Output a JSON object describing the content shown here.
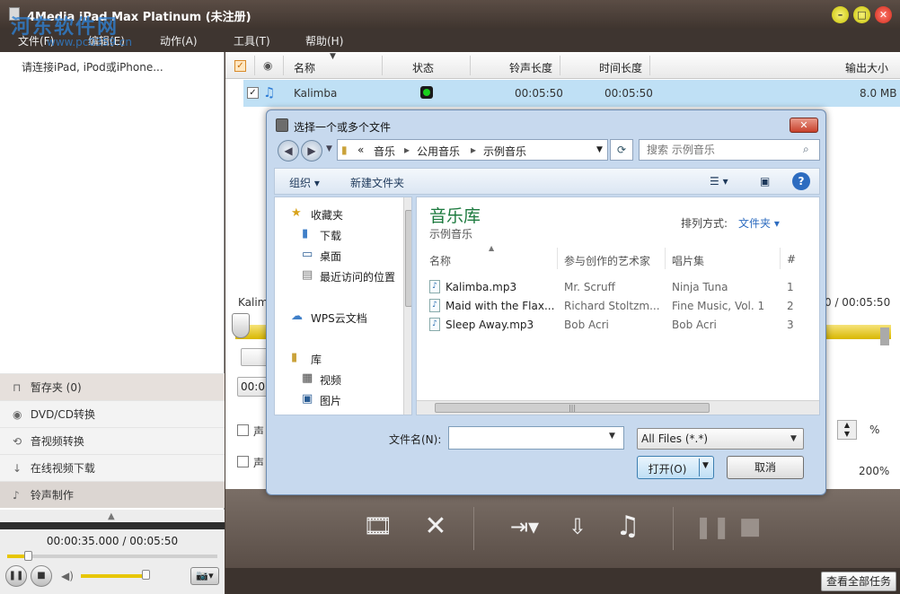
{
  "app": {
    "title": "4Media iPad Max Platinum (未注册)",
    "menu": [
      "文件(F)",
      "编辑(E)",
      "动作(A)",
      "工具(T)",
      "帮助(H)"
    ],
    "watermark": {
      "line1": "河东软件网",
      "line2": "www.pc0359.cn"
    }
  },
  "left": {
    "device_hint": "请连接iPad, iPod或iPhone...",
    "nav": [
      {
        "label": "暂存夹 (0)",
        "icon": "tray-icon"
      },
      {
        "label": "DVD/CD转换",
        "icon": "disc-icon"
      },
      {
        "label": "音视频转换",
        "icon": "convert-icon"
      },
      {
        "label": "在线视频下载",
        "icon": "download-icon"
      },
      {
        "label": "铃声制作",
        "icon": "bell-icon"
      }
    ],
    "player": {
      "time": "00:00:35.000 / 00:05:50",
      "progress": 0.1,
      "volume": 0.95
    }
  },
  "list": {
    "headers": {
      "name": "名称",
      "status": "状态",
      "ringtone_len": "铃声长度",
      "duration": "时间长度",
      "output_size": "输出大小"
    },
    "rows": [
      {
        "name": "Kalimba",
        "ringtone_len": "00:05:50",
        "duration": "00:05:50",
        "size": "8.0 MB",
        "checked": true,
        "status": "ready"
      }
    ]
  },
  "right": {
    "kalim_partial": "Kalim",
    "time_partial": "0 / 00:05:50",
    "time_input_partial": "00:0",
    "label1_partial": "声",
    "label2_partial": "声",
    "percent": "%",
    "zoom": "200%"
  },
  "status": {
    "view_all": "查看全部任务"
  },
  "dialog": {
    "title": "选择一个或多个文件",
    "address": {
      "prefix": "«",
      "segments": [
        "音乐",
        "公用音乐",
        "示例音乐"
      ]
    },
    "search_placeholder": "搜索 示例音乐",
    "commands": {
      "organize": "组织 ▾",
      "new_folder": "新建文件夹"
    },
    "nav_pane": {
      "favorites": "收藏夹",
      "downloads": "下载",
      "desktop": "桌面",
      "recent": "最近访问的位置",
      "wps": "WPS云文档",
      "libraries": "库",
      "videos": "视频",
      "pictures": "图片"
    },
    "library": {
      "title": "音乐库",
      "subtitle": "示例音乐",
      "arrange_label": "排列方式:",
      "arrange_value": "文件夹 ▾"
    },
    "columns": {
      "name": "名称",
      "artist": "参与创作的艺术家",
      "album": "唱片集",
      "num": "#"
    },
    "files": [
      {
        "name": "Kalimba.mp3",
        "artist": "Mr. Scruff",
        "album": "Ninja Tuna",
        "num": "1"
      },
      {
        "name": "Maid with the Flax...",
        "artist": "Richard Stoltzm...",
        "album": "Fine Music, Vol. 1",
        "num": "2"
      },
      {
        "name": "Sleep Away.mp3",
        "artist": "Bob Acri",
        "album": "Bob Acri",
        "num": "3"
      }
    ],
    "filename_label": "文件名(N):",
    "filename_value": "",
    "filter": "All Files (*.*)",
    "open_label": "打开(O)",
    "cancel_label": "取消"
  }
}
